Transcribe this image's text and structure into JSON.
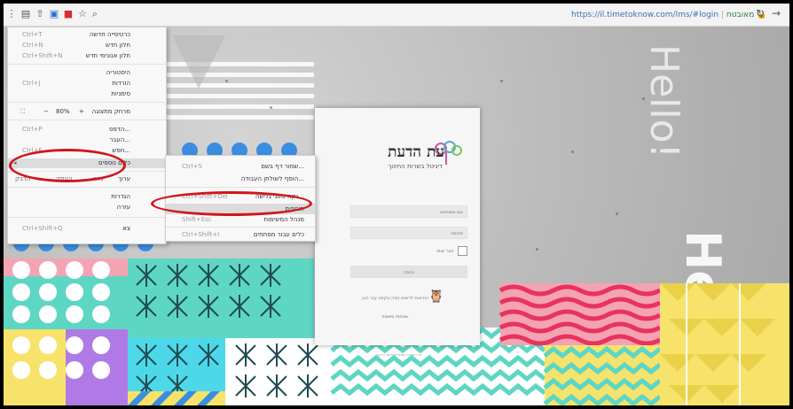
{
  "browser": {
    "url": "https://il.timetoknow.com/lms/#login",
    "security_label": "מאובטח"
  },
  "menu": {
    "items": [
      {
        "label": "כרטיסייה חדשה",
        "shortcut": "Ctrl+T"
      },
      {
        "label": "חלון חדש",
        "shortcut": "Ctrl+N"
      },
      {
        "label": "חלון אנונימי חדש",
        "shortcut": "Ctrl+Shift+N"
      },
      {
        "label": "היסטוריה",
        "shortcut": ""
      },
      {
        "label": "הורדות",
        "shortcut": "Ctrl+J"
      },
      {
        "label": "סימניות",
        "shortcut": ""
      },
      {
        "label": "מרחק מתצוגה",
        "shortcut": ""
      },
      {
        "label": "הדפס...",
        "shortcut": "Ctrl+P"
      },
      {
        "label": "העבר...",
        "shortcut": ""
      },
      {
        "label": "חפש...",
        "shortcut": "Ctrl+F"
      },
      {
        "label": "כלים נוספים",
        "shortcut": ""
      },
      {
        "label": "ערוך",
        "shortcut": ""
      },
      {
        "label": "הגדרות",
        "shortcut": ""
      },
      {
        "label": "עזרה",
        "shortcut": ""
      },
      {
        "label": "צא",
        "shortcut": "Ctrl+Shift+Q"
      }
    ],
    "zoom": {
      "minus": "−",
      "value": "80%",
      "plus": "+",
      "full": "⛶"
    },
    "edit_row": {
      "cut": "גזור",
      "copy": "העתק",
      "paste": "הדבק"
    }
  },
  "submenu": {
    "items": [
      {
        "label": "שמור דף בשם...",
        "shortcut": "Ctrl+S"
      },
      {
        "label": "הוסף לשולחן העבודה...",
        "shortcut": ""
      },
      {
        "label": "נקה נתוני גלישה...",
        "shortcut": "Ctrl+Shift+Del"
      },
      {
        "label": "תוספים",
        "shortcut": ""
      },
      {
        "label": "מנהל המשימות",
        "shortcut": "Shift+Esc"
      },
      {
        "label": "כלים עבור מפתחים",
        "shortcut": "Ctrl+Shift+I"
      }
    ]
  },
  "login": {
    "logo_title": "עת הדעת",
    "logo_subtitle": "דיגיטל בשרות החינוך",
    "username_placeholder": "שם משתמש",
    "password_placeholder": "סיסמה",
    "remember_label": "זכור אותי",
    "login_button": "כניסה",
    "hint_text": "הוראות לרשום כמה טקסט עזר כאן",
    "register_link": "שכחתי סיסמה",
    "footer_text": "כל הזכויות שמורות לעת הדעת"
  },
  "graffiti_text": "Hello!",
  "colors": {
    "highlight_ring": "#d0161c",
    "teal": "#5ed6c4",
    "pink": "#f4607b",
    "yellow": "#f7e36b",
    "purple": "#b07ae6",
    "blue": "#3a8de0"
  }
}
